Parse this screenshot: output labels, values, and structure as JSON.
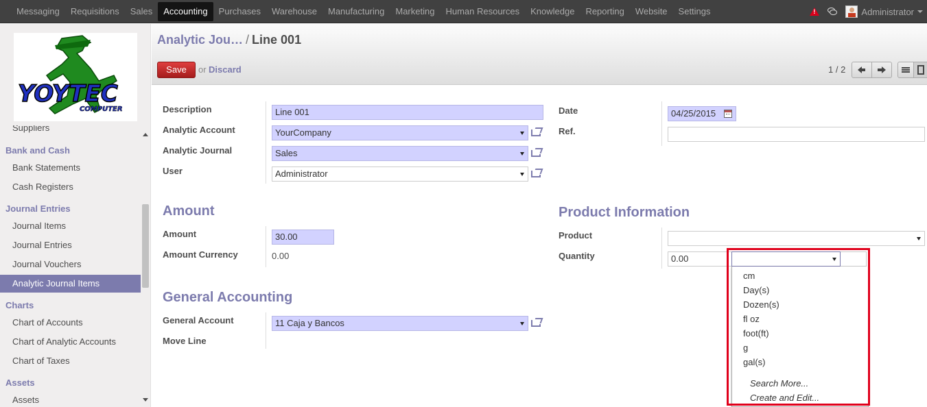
{
  "topbar": {
    "menu": [
      "Messaging",
      "Requisitions",
      "Sales",
      "Accounting",
      "Purchases",
      "Warehouse",
      "Manufacturing",
      "Marketing",
      "Human Resources",
      "Knowledge",
      "Reporting",
      "Website",
      "Settings"
    ],
    "active": "Accounting",
    "user": "Administrator"
  },
  "logo": {
    "line1": "YOYTEC",
    "line2": "COMPUTER"
  },
  "sidebar": {
    "partial_item": "Suppliers",
    "sections": [
      {
        "title": "Bank and Cash",
        "items": [
          "Bank Statements",
          "Cash Registers"
        ]
      },
      {
        "title": "Journal Entries",
        "items": [
          "Journal Items",
          "Journal Entries",
          "Journal Vouchers",
          "Analytic Journal Items"
        ]
      },
      {
        "title": "Charts",
        "items": [
          "Chart of Accounts",
          "Chart of Analytic Accounts",
          "Chart of Taxes"
        ]
      },
      {
        "title": "Assets",
        "items": [
          "Assets"
        ]
      }
    ],
    "active_item": "Analytic Journal Items"
  },
  "control": {
    "breadcrumb_parent": "Analytic Jou…",
    "breadcrumb_sep": "/",
    "breadcrumb_current": "Line 001",
    "save": "Save",
    "or": "or",
    "discard": "Discard",
    "pager": "1 / 2"
  },
  "form": {
    "description_label": "Description",
    "description": "Line 001",
    "analytic_account_label": "Analytic Account",
    "analytic_account": "YourCompany",
    "analytic_journal_label": "Analytic Journal",
    "analytic_journal": "Sales",
    "user_label": "User",
    "user": "Administrator",
    "date_label": "Date",
    "date": "04/25/2015",
    "ref_label": "Ref.",
    "ref": "",
    "amount_section": "Amount",
    "amount_label": "Amount",
    "amount": "30.00",
    "amount_currency_label": "Amount Currency",
    "amount_currency": "0.00",
    "product_section": "Product Information",
    "product_label": "Product",
    "product": "",
    "quantity_label": "Quantity",
    "quantity": "0.00",
    "uom": "",
    "general_section": "General Accounting",
    "general_account_label": "General Account",
    "general_account": "11 Caja y Bancos",
    "move_line_label": "Move Line"
  },
  "uom_dropdown": {
    "options": [
      "cm",
      "Day(s)",
      "Dozen(s)",
      "fl oz",
      "foot(ft)",
      "g",
      "gal(s)"
    ],
    "search_more": "Search More...",
    "create_edit": "Create and Edit..."
  },
  "colors": {
    "accent": "#7c7bad",
    "required_bg": "#d2d2ff",
    "save": "#c22a2a",
    "highlight": "#e0001b"
  }
}
